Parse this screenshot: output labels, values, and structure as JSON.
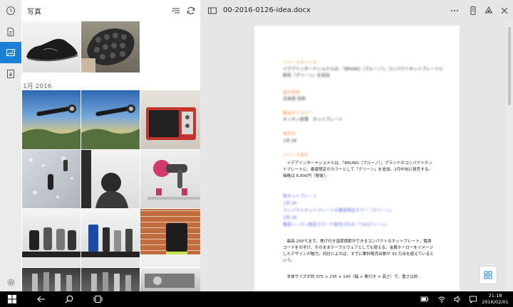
{
  "photos": {
    "title": "写真",
    "section_label": "1月 2016",
    "thumbnails": [
      {
        "subject": "shoe-side"
      },
      {
        "subject": "shoe-sole"
      },
      {
        "subject": "shaver-landscape"
      },
      {
        "subject": "shaver-landscape"
      },
      {
        "subject": "toaster-oven"
      },
      {
        "subject": "shaver-wall-display"
      },
      {
        "subject": "person-presentation"
      },
      {
        "subject": "hair-dryer"
      },
      {
        "subject": "shaver-display-panasonic"
      },
      {
        "subject": "grooming-products"
      },
      {
        "subject": "speaker-display"
      },
      {
        "subject": "shaver-lineup"
      },
      {
        "subject": "shaver-lineup"
      },
      {
        "subject": "display-booth"
      }
    ]
  },
  "document": {
    "filename": "00-2016-0126-idea.docx",
    "header_lines": [
      {
        "style": "orange",
        "text": "リリースタイトル"
      },
      {
        "style": "dark",
        "text": "イデアインターナショナルは、「BRUNO（ブルーノ）」コンパクトホットプレートに"
      },
      {
        "style": "dark",
        "text": "新色「グリーン」を追加"
      },
      {
        "style": "orange",
        "text": "会社名称"
      },
      {
        "style": "dark",
        "text": "日本語 名称"
      },
      {
        "style": "orange",
        "text": "製品カテゴリー"
      },
      {
        "style": "dark",
        "text": "キッチン家電　ホットプレート"
      },
      {
        "style": "orange",
        "text": "発売日"
      },
      {
        "style": "dark",
        "text": "1月 26"
      },
      {
        "style": "orange",
        "text": "リリース本文"
      }
    ],
    "paragraph_1": "　イデアインターナショナルは、「BRUNO（ブルーノ）」ブランドのコンパクトホットプレートに、春夏限定のカラーとして「グリーン」を追加。2月中旬に発売する。価格は 8,800円（税抜）。",
    "link_lines": [
      "新ホットプレート",
      "1月 26",
      "コンパクトホットプレートの春夏限定カラー「グリーン」",
      "2月 26",
      "春夏シーズン限定カラーで発売される「つみグリーン」"
    ],
    "paragraph_2": "　最高 250℃まで、焦げ付き温度調節ができるコンパクトなホットプレート。電源コードをのぞけ、そのままテーブルウェアとしても使える。金属ホーローをイメージしたデザインが魅力。同社によれば、すでに累計販売台数が 33 万台を超えているという。",
    "paragraph_3": "　本体サイズが約 375 × 235 × 140（幅 × 奥行き × 高さ）で、重さは約"
  },
  "taskbar": {
    "time": "21:18",
    "date": "2016/02/01"
  },
  "colors": {
    "accent": "#1c7fd6",
    "heading_orange": "#e8893a",
    "link_blue": "#5a63e0"
  }
}
